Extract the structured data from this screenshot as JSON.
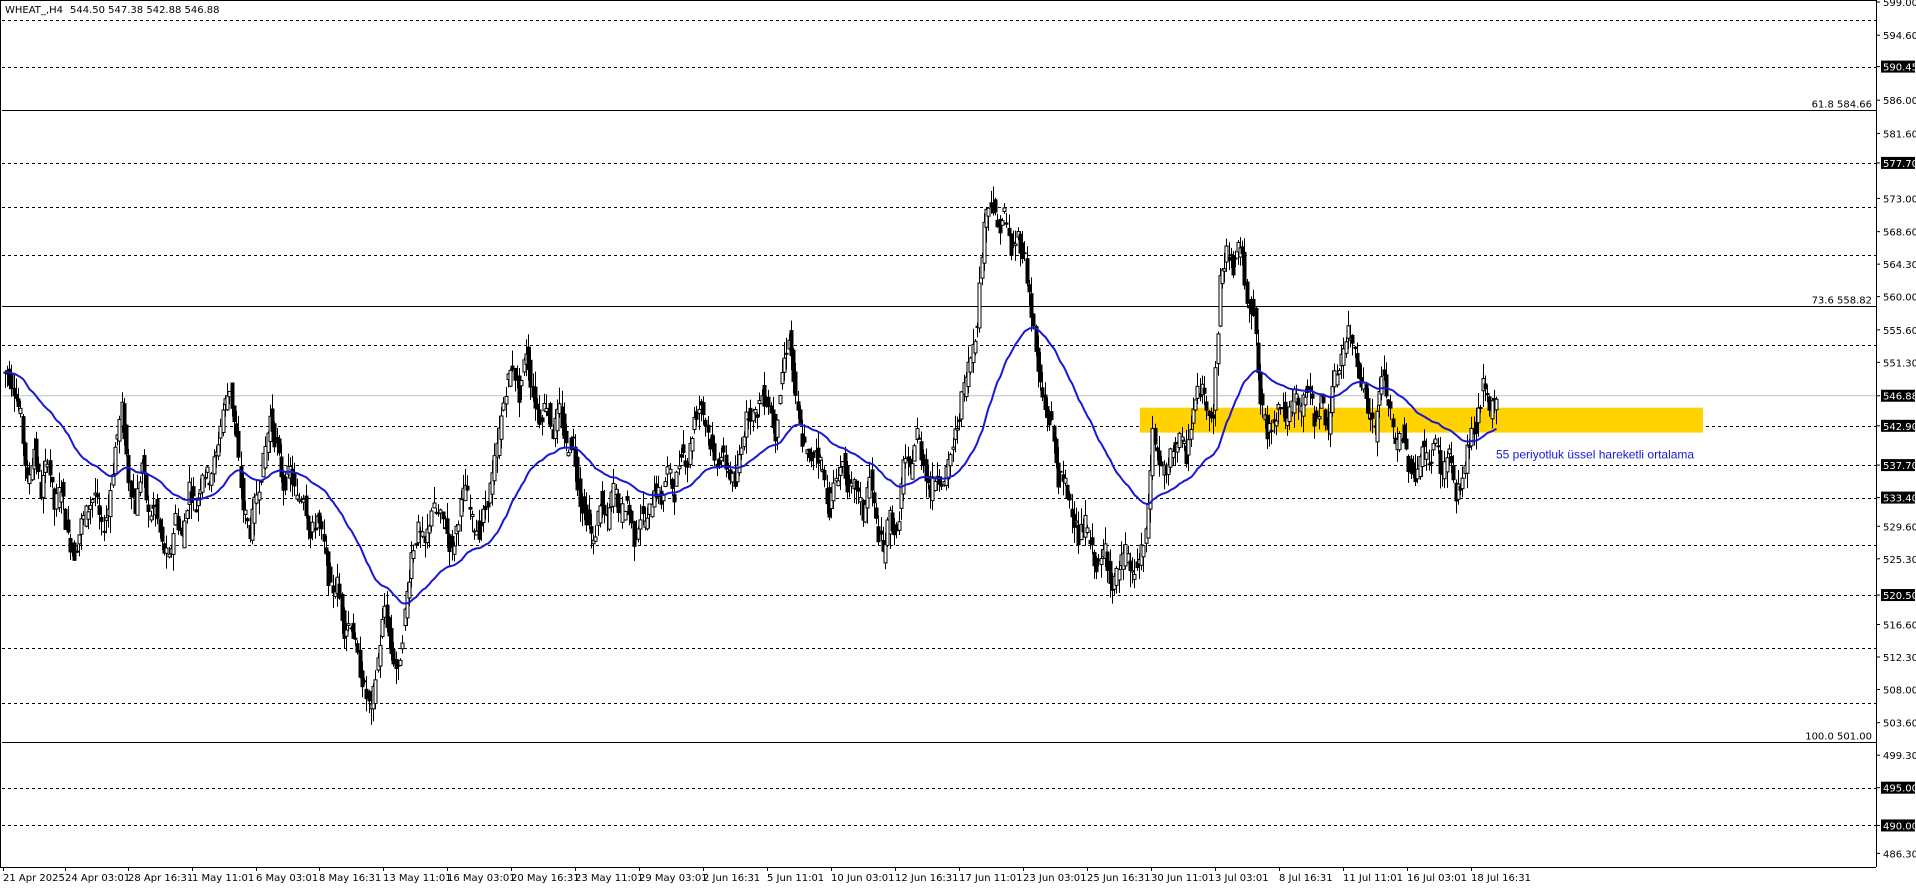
{
  "header": {
    "symbol": "WHEAT_,H4",
    "ohlc": "544.50 547.38 542.88 546.88"
  },
  "colors": {
    "background": "#ffffff",
    "candle": "#000000",
    "ema": "#1818d6",
    "zone": "#ffd200",
    "grid": "#000000",
    "price_line": "#c0c0c0"
  },
  "chart_data": {
    "type": "candlestick",
    "title": "WHEAT_,H4",
    "ylim": [
      484.5,
      599.0
    ],
    "y_ticks": [
      "599.00",
      "594.60",
      "590.45",
      "586.00",
      "581.60",
      "577.70",
      "573.00",
      "568.60",
      "564.30",
      "560.00",
      "555.60",
      "551.30",
      "546.88",
      "542.90",
      "537.70",
      "533.40",
      "529.60",
      "525.30",
      "520.50",
      "516.60",
      "512.30",
      "508.00",
      "503.60",
      "499.30",
      "495.00",
      "490.00",
      "486.30"
    ],
    "x_ticks": [
      "21 Apr 2025",
      "24 Apr 03:01",
      "28 Apr 16:31",
      "1 May 11:01",
      "6 May 03:01",
      "8 May 16:31",
      "13 May 11:01",
      "16 May 03:01",
      "20 May 16:31",
      "23 May 11:01",
      "29 May 03:01",
      "2 Jun 16:31",
      "5 Jun 11:01",
      "10 Jun 03:01",
      "12 Jun 16:31",
      "17 Jun 11:01",
      "23 Jun 03:01",
      "25 Jun 16:31",
      "30 Jun 11:01",
      "3 Jul 03:01",
      "8 Jul 16:31",
      "11 Jul 11:01",
      "16 Jul 03:01",
      "18 Jul 16:31"
    ],
    "dashed_levels": [
      596.6,
      590.45,
      577.7,
      571.8,
      565.45,
      553.65,
      542.9,
      537.7,
      533.4,
      527.1,
      520.5,
      513.45,
      506.15,
      495.0,
      490.0
    ],
    "fib_levels": [
      {
        "label": "61.8 584.66",
        "value": 584.66
      },
      {
        "label": "73.6 558.82",
        "value": 558.82
      },
      {
        "label": "100.0 501.00",
        "value": 501.0
      }
    ],
    "current_price": 546.88,
    "zone": {
      "low": 542.0,
      "high": 545.3,
      "label": "55 periyotluk üssel hareketli ortalama"
    },
    "ema_period": 55,
    "price_path": [
      [
        0,
        550
      ],
      [
        1,
        548
      ],
      [
        2,
        544
      ],
      [
        3,
        535
      ],
      [
        4,
        540
      ],
      [
        5,
        534
      ],
      [
        6,
        539
      ],
      [
        7,
        532
      ],
      [
        8,
        535
      ],
      [
        9,
        528
      ],
      [
        10,
        526
      ],
      [
        11,
        530
      ],
      [
        12,
        532
      ],
      [
        13,
        534
      ],
      [
        14,
        529
      ],
      [
        15,
        532
      ],
      [
        16,
        540
      ],
      [
        17,
        545
      ],
      [
        18,
        536
      ],
      [
        19,
        532
      ],
      [
        20,
        538
      ],
      [
        21,
        531
      ],
      [
        22,
        532
      ],
      [
        23,
        527
      ],
      [
        24,
        525
      ],
      [
        25,
        531
      ],
      [
        26,
        528
      ],
      [
        27,
        535
      ],
      [
        28,
        532
      ],
      [
        29,
        537
      ],
      [
        30,
        536
      ],
      [
        31,
        539
      ],
      [
        32,
        545
      ],
      [
        33,
        548
      ],
      [
        34,
        541
      ],
      [
        35,
        532
      ],
      [
        36,
        529
      ],
      [
        37,
        534
      ],
      [
        38,
        538
      ],
      [
        39,
        544
      ],
      [
        40,
        540
      ],
      [
        41,
        535
      ],
      [
        42,
        537
      ],
      [
        43,
        533
      ],
      [
        44,
        534
      ],
      [
        45,
        528
      ],
      [
        46,
        531
      ],
      [
        47,
        527
      ],
      [
        48,
        521
      ],
      [
        49,
        522
      ],
      [
        50,
        516
      ],
      [
        51,
        517
      ],
      [
        52,
        512
      ],
      [
        53,
        508
      ],
      [
        54,
        505
      ],
      [
        55,
        512
      ],
      [
        56,
        519
      ],
      [
        57,
        513
      ],
      [
        58,
        510
      ],
      [
        59,
        518
      ],
      [
        60,
        526
      ],
      [
        61,
        529
      ],
      [
        62,
        527
      ],
      [
        63,
        532
      ],
      [
        64,
        531
      ],
      [
        65,
        530
      ],
      [
        66,
        526
      ],
      [
        67,
        531
      ],
      [
        68,
        535
      ],
      [
        69,
        530
      ],
      [
        70,
        529
      ],
      [
        71,
        532
      ],
      [
        72,
        536
      ],
      [
        73,
        542
      ],
      [
        74,
        548
      ],
      [
        75,
        551
      ],
      [
        76,
        547
      ],
      [
        77,
        553
      ],
      [
        78,
        547
      ],
      [
        79,
        544
      ],
      [
        80,
        546
      ],
      [
        81,
        542
      ],
      [
        82,
        545
      ],
      [
        83,
        540
      ],
      [
        84,
        541
      ],
      [
        85,
        533
      ],
      [
        86,
        531
      ],
      [
        87,
        527
      ],
      [
        88,
        533
      ],
      [
        89,
        530
      ],
      [
        90,
        535
      ],
      [
        91,
        531
      ],
      [
        92,
        533
      ],
      [
        93,
        528
      ],
      [
        94,
        531
      ],
      [
        95,
        530
      ],
      [
        96,
        535
      ],
      [
        97,
        533
      ],
      [
        98,
        537
      ],
      [
        99,
        534
      ],
      [
        100,
        540
      ],
      [
        101,
        538
      ],
      [
        102,
        544
      ],
      [
        103,
        546
      ],
      [
        104,
        542
      ],
      [
        105,
        538
      ],
      [
        106,
        539
      ],
      [
        107,
        537
      ],
      [
        108,
        535
      ],
      [
        109,
        541
      ],
      [
        110,
        545
      ],
      [
        111,
        544
      ],
      [
        112,
        547
      ],
      [
        113,
        546
      ],
      [
        114,
        542
      ],
      [
        115,
        550
      ],
      [
        116,
        555
      ],
      [
        117,
        546
      ],
      [
        118,
        541
      ],
      [
        119,
        538
      ],
      [
        120,
        540
      ],
      [
        121,
        537
      ],
      [
        122,
        532
      ],
      [
        123,
        536
      ],
      [
        124,
        538
      ],
      [
        125,
        534
      ],
      [
        126,
        535
      ],
      [
        127,
        531
      ],
      [
        128,
        536
      ],
      [
        129,
        530
      ],
      [
        130,
        526
      ],
      [
        131,
        531
      ],
      [
        132,
        528
      ],
      [
        133,
        538
      ],
      [
        134,
        537
      ],
      [
        135,
        542
      ],
      [
        136,
        538
      ],
      [
        137,
        534
      ],
      [
        138,
        537
      ],
      [
        139,
        535
      ],
      [
        140,
        539
      ],
      [
        141,
        543
      ],
      [
        142,
        548
      ],
      [
        143,
        552
      ],
      [
        144,
        557
      ],
      [
        145,
        570
      ],
      [
        146,
        573
      ],
      [
        147,
        569
      ],
      [
        148,
        571
      ],
      [
        149,
        566
      ],
      [
        150,
        568
      ],
      [
        151,
        565
      ],
      [
        152,
        558
      ],
      [
        153,
        550
      ],
      [
        154,
        545
      ],
      [
        155,
        543
      ],
      [
        156,
        536
      ],
      [
        157,
        535
      ],
      [
        158,
        532
      ],
      [
        159,
        528
      ],
      [
        160,
        530
      ],
      [
        161,
        526
      ],
      [
        162,
        524
      ],
      [
        163,
        527
      ],
      [
        164,
        521
      ],
      [
        165,
        524
      ],
      [
        166,
        526
      ],
      [
        167,
        523
      ],
      [
        168,
        525
      ],
      [
        169,
        528
      ],
      [
        170,
        542
      ],
      [
        171,
        538
      ],
      [
        172,
        536
      ],
      [
        173,
        540
      ],
      [
        174,
        541
      ],
      [
        175,
        539
      ],
      [
        176,
        545
      ],
      [
        177,
        548
      ],
      [
        178,
        546
      ],
      [
        179,
        544
      ],
      [
        180,
        562
      ],
      [
        181,
        566
      ],
      [
        182,
        564
      ],
      [
        183,
        567
      ],
      [
        184,
        560
      ],
      [
        185,
        558
      ],
      [
        186,
        546
      ],
      [
        187,
        542
      ],
      [
        188,
        544
      ],
      [
        189,
        546
      ],
      [
        190,
        543
      ],
      [
        191,
        547
      ],
      [
        192,
        545
      ],
      [
        193,
        548
      ],
      [
        194,
        544
      ],
      [
        195,
        546
      ],
      [
        196,
        543
      ],
      [
        197,
        549
      ],
      [
        198,
        552
      ],
      [
        199,
        555
      ],
      [
        200,
        553
      ],
      [
        201,
        549
      ],
      [
        202,
        545
      ],
      [
        203,
        542
      ],
      [
        204,
        550
      ],
      [
        205,
        546
      ],
      [
        206,
        540
      ],
      [
        207,
        542
      ],
      [
        208,
        538
      ],
      [
        209,
        536
      ],
      [
        210,
        540
      ],
      [
        211,
        538
      ],
      [
        212,
        541
      ],
      [
        213,
        536
      ],
      [
        214,
        540
      ],
      [
        215,
        533
      ],
      [
        216,
        536
      ],
      [
        217,
        541
      ],
      [
        218,
        543
      ],
      [
        219,
        548
      ],
      [
        220,
        545
      ],
      [
        221,
        546.88
      ]
    ]
  }
}
